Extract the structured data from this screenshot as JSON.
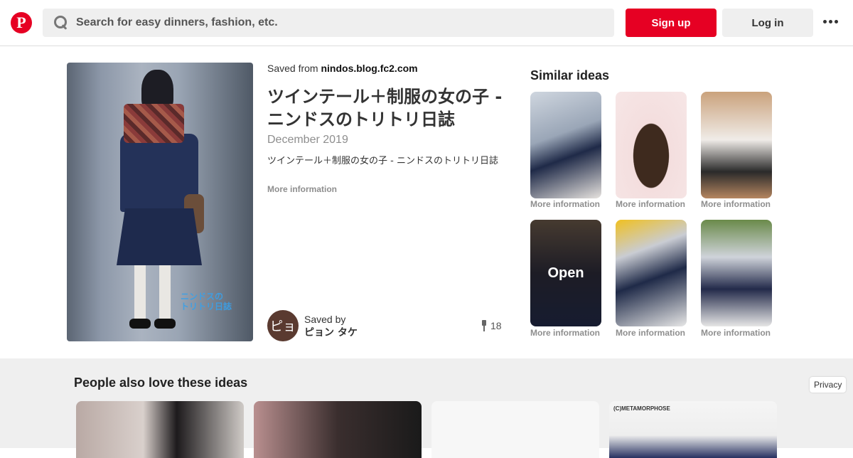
{
  "header": {
    "logo_letter": "P",
    "search_placeholder": "Search for easy dinners, fashion, etc.",
    "signup_label": "Sign up",
    "login_label": "Log in",
    "brand_color": "#e60023"
  },
  "pin": {
    "saved_from_prefix": "Saved from",
    "saved_from_domain": "nindos.blog.fc2.com",
    "title": "ツインテール＋制服の女の子 - ニンドスのトリトリ日誌",
    "date": "December 2019",
    "description": "ツインテール＋制服の女の子 - ニンドスのトリトリ日誌",
    "more_info": "More information",
    "image_watermark_line1": "ニンドスの",
    "image_watermark_line2": "トリトリ日誌",
    "saved_by_label": "Saved by",
    "saved_by_name": "ピョン タケ",
    "avatar_text": "ピョ",
    "repin_count": "18"
  },
  "similar": {
    "title": "Similar ideas",
    "open_label": "Open",
    "items": [
      {
        "label": "More information"
      },
      {
        "label": "More information"
      },
      {
        "label": "More information"
      },
      {
        "label": "More information"
      },
      {
        "label": "More information"
      },
      {
        "label": "More information"
      }
    ]
  },
  "bottom": {
    "title": "People also love these ideas",
    "privacy_label": "Privacy",
    "card4_caption": "(C)METAMORPHOSE"
  }
}
